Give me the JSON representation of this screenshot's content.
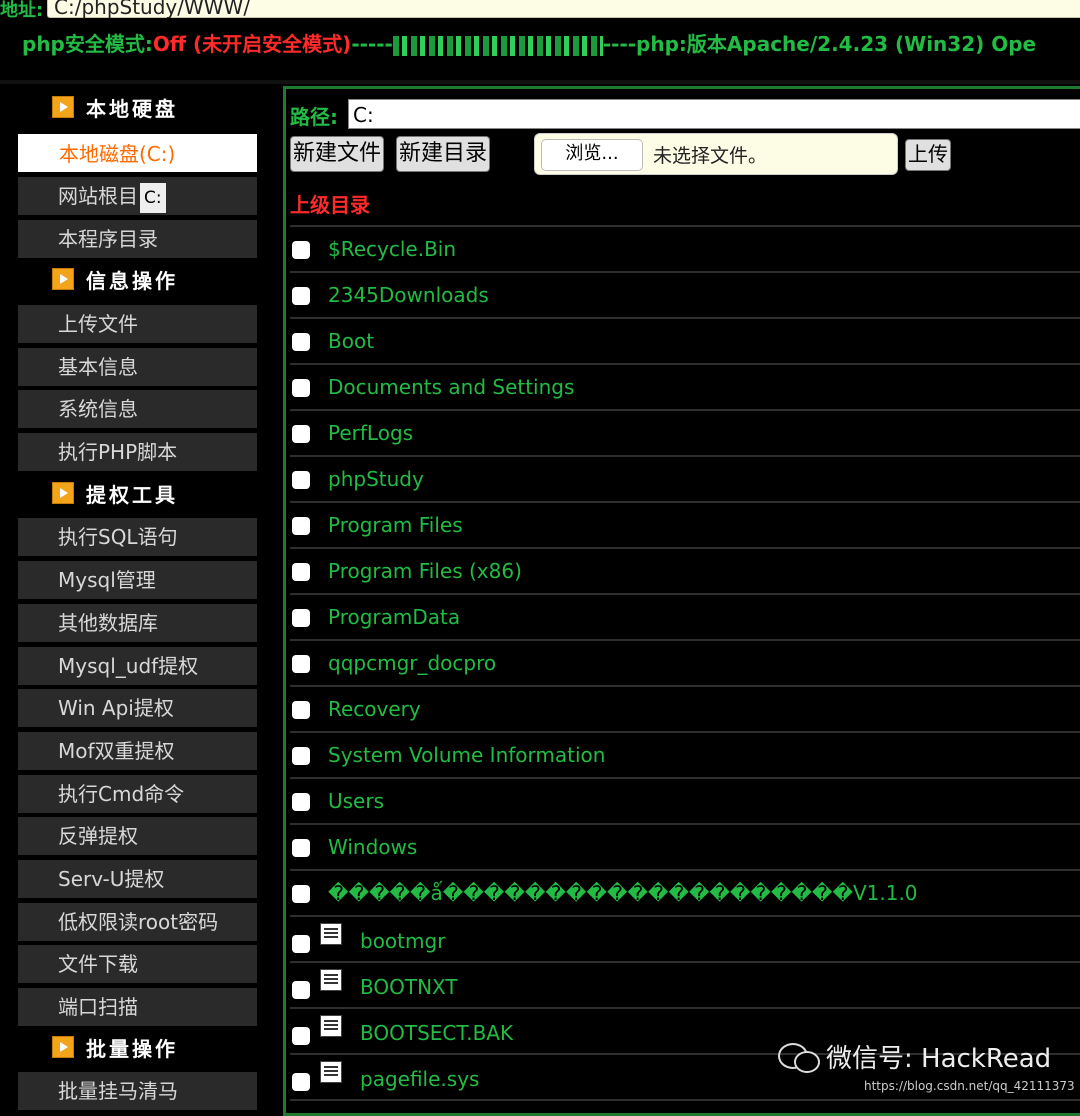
{
  "header": {
    "address_label": "地址:",
    "address_value": "C:/phpStudy/WWW/",
    "status_part1": "php安全模式:",
    "status_part2": "Off (未开启安全模式)",
    "status_part3": "-----",
    "status_part4": "----php:版本Apache/2.4.23 (Win32) Ope"
  },
  "sidebar": {
    "sections": [
      {
        "title": "本地硬盘"
      },
      {
        "title": "信息操作"
      },
      {
        "title": "提权工具"
      },
      {
        "title": "批量操作"
      }
    ],
    "items": [
      {
        "label": "本地磁盘(C:)"
      },
      {
        "label": "网站根目",
        "badge": "C:"
      },
      {
        "label": "本程序目录"
      },
      {
        "label": "上传文件"
      },
      {
        "label": "基本信息"
      },
      {
        "label": "系统信息"
      },
      {
        "label": "执行PHP脚本"
      },
      {
        "label": "执行SQL语句"
      },
      {
        "label": "Mysql管理"
      },
      {
        "label": "其他数据库"
      },
      {
        "label": "Mysql_udf提权"
      },
      {
        "label": "Win Api提权"
      },
      {
        "label": "Mof双重提权"
      },
      {
        "label": "执行Cmd命令"
      },
      {
        "label": "反弹提权"
      },
      {
        "label": "Serv-U提权"
      },
      {
        "label": "低权限读root密码"
      },
      {
        "label": "文件下载"
      },
      {
        "label": "端口扫描"
      },
      {
        "label": "批量挂马清马"
      }
    ]
  },
  "main": {
    "path_label": "路径:",
    "path_value": "C:",
    "new_file_label": "新建文件",
    "new_dir_label": "新建目录",
    "browse_label": "浏览...",
    "file_status": "未选择文件。",
    "upload_label": "上传",
    "parent_dir_label": "上级目录",
    "folders": [
      "$Recycle.Bin",
      "2345Downloads",
      "Boot",
      "Documents and Settings",
      "PerfLogs",
      "phpStudy",
      "Program Files",
      "Program Files (x86)",
      "ProgramData",
      "qqpcmgr_docpro",
      "Recovery",
      "System Volume Information",
      "Users",
      "Windows",
      "�����ǻ��������������������V1.1.0"
    ],
    "files": [
      "bootmgr",
      "BOOTNXT",
      "BOOTSECT.BAK",
      "pagefile.sys"
    ]
  },
  "watermark": {
    "text": "微信号: HackRead",
    "url": "https://blog.csdn.net/qq_42111373"
  }
}
